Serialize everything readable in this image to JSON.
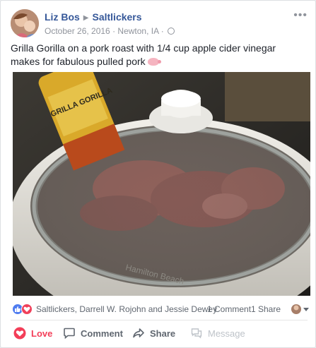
{
  "post": {
    "author": "Liz Bos",
    "page": "Saltlickers",
    "date": "October 26, 2016",
    "location": "Newton, IA",
    "separator": "·",
    "text": "Grilla Gorilla on a pork roast with 1/4 cup apple cider vinegar makes for fabulous pulled pork",
    "photo_label": "GRILLA GORILLA",
    "appliance_brand": "Hamilton Beach"
  },
  "reactions": {
    "names": "Saltlickers, Darrell W. Rojohn and Jessie Dewey",
    "comments": "1 Comment",
    "shares": "1 Share"
  },
  "actions": {
    "love": "Love",
    "comment": "Comment",
    "share": "Share",
    "message": "Message"
  },
  "colors": {
    "link": "#365899",
    "love": "#f33e58",
    "like": "#4f7cf0",
    "muted": "#90949c"
  }
}
